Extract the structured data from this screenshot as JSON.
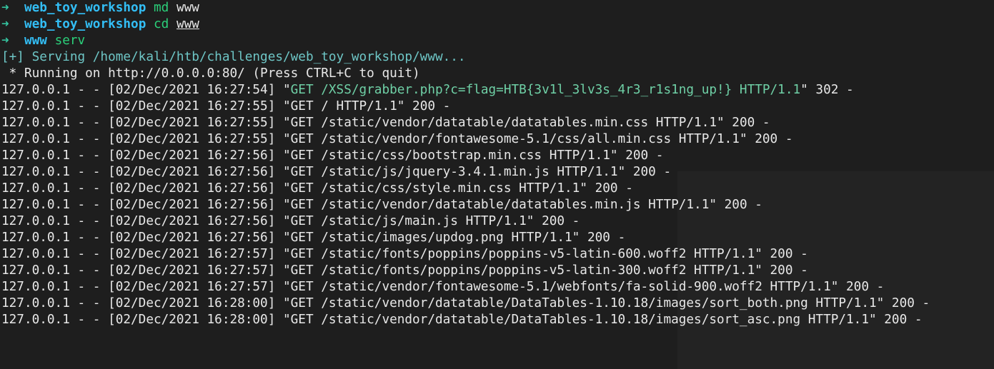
{
  "prompts": [
    {
      "arrow": "➜",
      "dir": "web_toy_workshop",
      "command": "md",
      "arg": "www",
      "arg_underlined": false
    },
    {
      "arrow": "➜",
      "dir": "web_toy_workshop",
      "command": "cd",
      "arg": "www",
      "arg_underlined": true
    },
    {
      "arrow": "➜",
      "dir": "www",
      "command": "serv",
      "arg": "",
      "arg_underlined": false
    }
  ],
  "serving_line": "[+] Serving /home/kali/htb/challenges/web_toy_workshop/www...",
  "running_line": " * Running on http://0.0.0.0:80/ (Press CTRL+C to quit)",
  "log_entries": [
    {
      "prefix": "127.0.0.1 - - [02/Dec/2021 16:27:54] \"",
      "request": "GET /XSS/grabber.php?c=flag=HTB{3v1l_3lv3s_4r3_r1s1ng_up!} HTTP/1.1",
      "suffix": "\" 302 -",
      "highlight": true
    },
    {
      "prefix": "127.0.0.1 - - [02/Dec/2021 16:27:55] \"",
      "request": "GET / HTTP/1.1",
      "suffix": "\" 200 -",
      "highlight": false
    },
    {
      "prefix": "127.0.0.1 - - [02/Dec/2021 16:27:55] \"",
      "request": "GET /static/vendor/datatable/datatables.min.css HTTP/1.1",
      "suffix": "\" 200 -",
      "highlight": false
    },
    {
      "prefix": "127.0.0.1 - - [02/Dec/2021 16:27:55] \"",
      "request": "GET /static/vendor/fontawesome-5.1/css/all.min.css HTTP/1.1",
      "suffix": "\" 200 -",
      "highlight": false
    },
    {
      "prefix": "127.0.0.1 - - [02/Dec/2021 16:27:56] \"",
      "request": "GET /static/css/bootstrap.min.css HTTP/1.1",
      "suffix": "\" 200 -",
      "highlight": false
    },
    {
      "prefix": "127.0.0.1 - - [02/Dec/2021 16:27:56] \"",
      "request": "GET /static/js/jquery-3.4.1.min.js HTTP/1.1",
      "suffix": "\" 200 -",
      "highlight": false
    },
    {
      "prefix": "127.0.0.1 - - [02/Dec/2021 16:27:56] \"",
      "request": "GET /static/css/style.min.css HTTP/1.1",
      "suffix": "\" 200 -",
      "highlight": false
    },
    {
      "prefix": "127.0.0.1 - - [02/Dec/2021 16:27:56] \"",
      "request": "GET /static/vendor/datatable/datatables.min.js HTTP/1.1",
      "suffix": "\" 200 -",
      "highlight": false
    },
    {
      "prefix": "127.0.0.1 - - [02/Dec/2021 16:27:56] \"",
      "request": "GET /static/js/main.js HTTP/1.1",
      "suffix": "\" 200 -",
      "highlight": false
    },
    {
      "prefix": "127.0.0.1 - - [02/Dec/2021 16:27:56] \"",
      "request": "GET /static/images/updog.png HTTP/1.1",
      "suffix": "\" 200 -",
      "highlight": false
    },
    {
      "prefix": "127.0.0.1 - - [02/Dec/2021 16:27:57] \"",
      "request": "GET /static/fonts/poppins/poppins-v5-latin-600.woff2 HTTP/1.1",
      "suffix": "\" 200 -",
      "highlight": false
    },
    {
      "prefix": "127.0.0.1 - - [02/Dec/2021 16:27:57] \"",
      "request": "GET /static/fonts/poppins/poppins-v5-latin-300.woff2 HTTP/1.1",
      "suffix": "\" 200 -",
      "highlight": false
    },
    {
      "prefix": "127.0.0.1 - - [02/Dec/2021 16:27:57] \"",
      "request": "GET /static/vendor/fontawesome-5.1/webfonts/fa-solid-900.woff2 HTTP/1.1",
      "suffix": "\" 200 -",
      "highlight": false
    },
    {
      "prefix": "127.0.0.1 - - [02/Dec/2021 16:28:00] \"",
      "request": "GET /static/vendor/datatable/DataTables-1.10.18/images/sort_both.png HTTP/1.1",
      "suffix": "\" 200 -",
      "highlight": false
    },
    {
      "prefix": "127.0.0.1 - - [02/Dec/2021 16:28:00] \"",
      "request": "GET /static/vendor/datatable/DataTables-1.10.18/images/sort_asc.png HTTP/1.1",
      "suffix": "\" 200 -",
      "highlight": false
    }
  ],
  "colors": {
    "background": "#1e1e1e",
    "prompt_arrow": "#35c4a0",
    "prompt_dir": "#33bef5",
    "command": "#2bd07a",
    "info": "#6ec6c6",
    "flag_request": "#6fd0a6",
    "text": "#e8e8e8"
  }
}
